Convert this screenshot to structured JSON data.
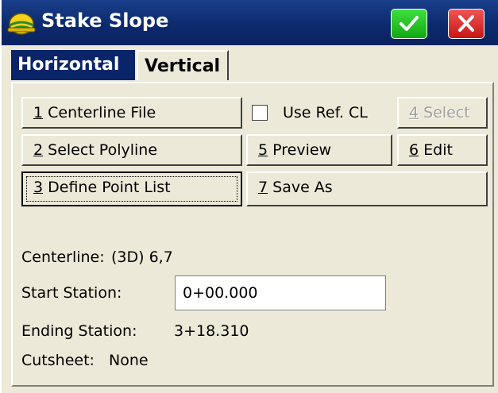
{
  "window": {
    "title": "Stake Slope",
    "icon": "helmet-icon",
    "ok_icon": "checkmark-icon",
    "close_icon": "close-icon"
  },
  "tabs": [
    {
      "label": "Horizontal",
      "active": true
    },
    {
      "label": "Vertical",
      "active": false
    }
  ],
  "buttons": {
    "centerline_file": {
      "key": "1",
      "label": " Centerline File"
    },
    "select_polyline": {
      "key": "2",
      "label": " Select Polyline"
    },
    "define_point_list": {
      "key": "3",
      "label": " Define Point List"
    },
    "select": {
      "key": "4",
      "label": " Select"
    },
    "preview": {
      "key": "5",
      "label": " Preview"
    },
    "edit": {
      "key": "6",
      "label": " Edit"
    },
    "save_as": {
      "key": "7",
      "label": " Save As"
    }
  },
  "use_ref_cl": {
    "label": "Use Ref. CL",
    "checked": false
  },
  "info": {
    "centerline_label": "Centerline:",
    "centerline_value": "(3D) 6,7",
    "start_station_label": "Start Station:",
    "start_station_value": "0+00.000",
    "ending_station_label": "Ending Station:",
    "ending_station_value": "3+18.310",
    "cutsheet_label": "Cutsheet:",
    "cutsheet_value": "None"
  },
  "colors": {
    "titlebar": "#0d2a6e",
    "ok_button": "#1fbf1f",
    "close_button": "#e02a2a",
    "dialog_bg": "#ece9d8"
  }
}
